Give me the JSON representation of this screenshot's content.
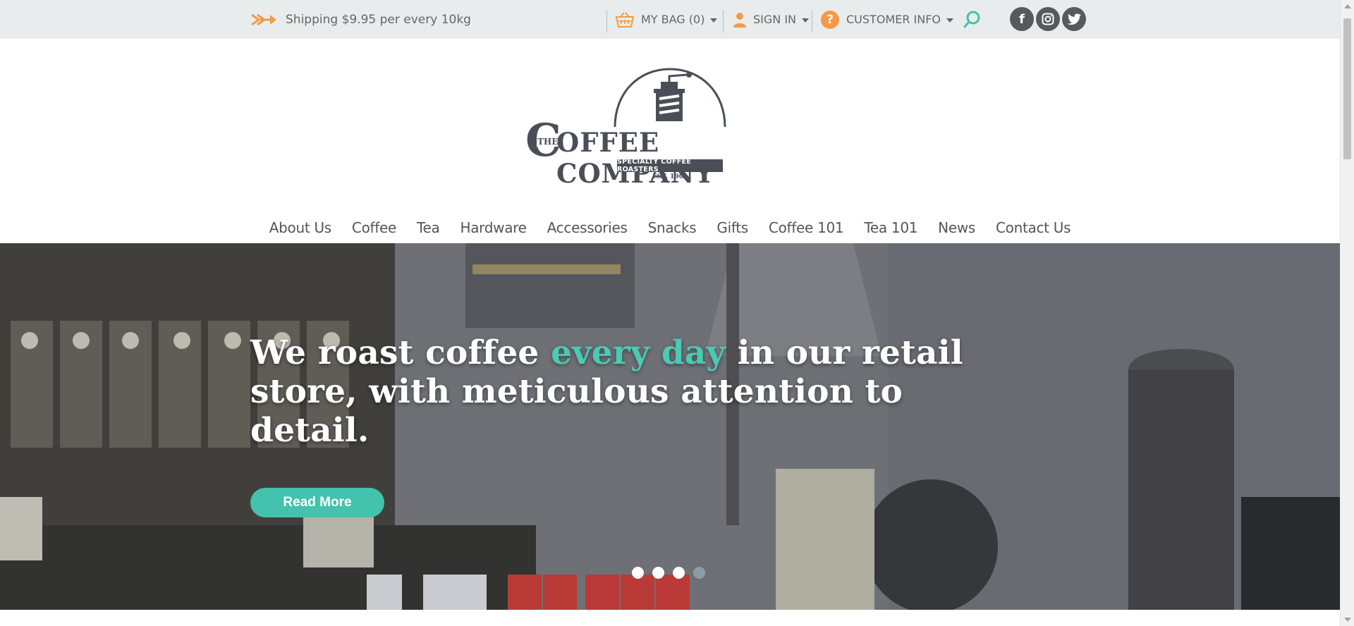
{
  "topbar": {
    "shipping_text": "Shipping $9.95 per every 10kg",
    "bag_label": "MY BAG (0)",
    "signin_label": "SIGN IN",
    "customer_info_label": "CUSTOMER INFO",
    "social": [
      {
        "name": "facebook-icon",
        "glyph": "f"
      },
      {
        "name": "instagram-icon",
        "glyph": "◙"
      },
      {
        "name": "twitter-icon",
        "glyph": "t"
      }
    ]
  },
  "logo": {
    "the": "THE",
    "name_left": "C",
    "name_main": "OFFEE COMPANY",
    "tagline": "SPECIALTY COFFEE ROASTERS",
    "est": "EST. 1969"
  },
  "nav": {
    "items": [
      "About Us",
      "Coffee",
      "Tea",
      "Hardware",
      "Accessories",
      "Snacks",
      "Gifts",
      "Coffee 101",
      "Tea 101",
      "News",
      "Contact Us"
    ]
  },
  "hero": {
    "headline_part1": "We roast coffee ",
    "headline_accent": "every day",
    "headline_part2": " in our retail store, with meticulous attention to detail.",
    "button_label": "Read More",
    "slide_count": 4,
    "active_slide": 4
  },
  "colors": {
    "accent": "#43c2ad",
    "topbar_bg": "#e8ecec",
    "orange": "#f49a47",
    "dark": "#555a5c"
  }
}
